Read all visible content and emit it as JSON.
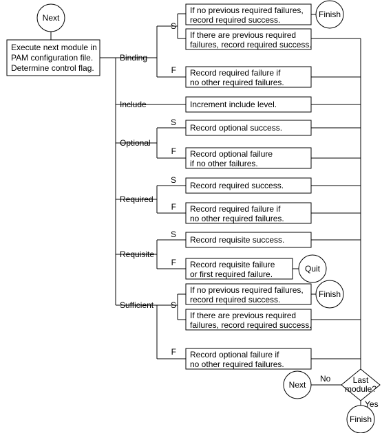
{
  "start": {
    "next": "Next"
  },
  "execute_box": {
    "l1": "Execute next module in",
    "l2": "PAM configuration file.",
    "l3": "Determine control flag."
  },
  "labels": {
    "S": "S",
    "F": "F"
  },
  "flags": {
    "binding": "Binding",
    "include": "Include",
    "optional": "Optional",
    "required": "Required",
    "requisite": "Requisite",
    "sufficient": "Sufficient"
  },
  "binding": {
    "s1": {
      "l1": "If no previous required failures,",
      "l2": "record required success."
    },
    "s2": {
      "l1": "If there are previous required",
      "l2": "failures, record required success."
    },
    "f": {
      "l1": "Record required failure if",
      "l2": "no other required failures."
    }
  },
  "include": {
    "l1": "Increment include level."
  },
  "optional": {
    "s": {
      "l1": "Record optional success."
    },
    "f": {
      "l1": "Record optional failure",
      "l2": "if no other failures."
    }
  },
  "required": {
    "s": {
      "l1": "Record required success."
    },
    "f": {
      "l1": "Record required failure if",
      "l2": "no other required failures."
    }
  },
  "requisite": {
    "s": {
      "l1": "Record requisite success."
    },
    "f": {
      "l1": "Record requisite failure",
      "l2": "or first required failure."
    }
  },
  "sufficient": {
    "s1": {
      "l1": "If no previous required failures,",
      "l2": "record required success."
    },
    "s2": {
      "l1": "If there are previous required",
      "l2": "failures, record required success."
    },
    "f": {
      "l1": "Record optional failure if",
      "l2": "no other required failures."
    }
  },
  "terminals": {
    "finish": "Finish",
    "quit": "Quit",
    "next": "Next"
  },
  "decision": {
    "last_l1": "Last",
    "last_l2": "module?",
    "yes": "Yes",
    "no": "No"
  }
}
